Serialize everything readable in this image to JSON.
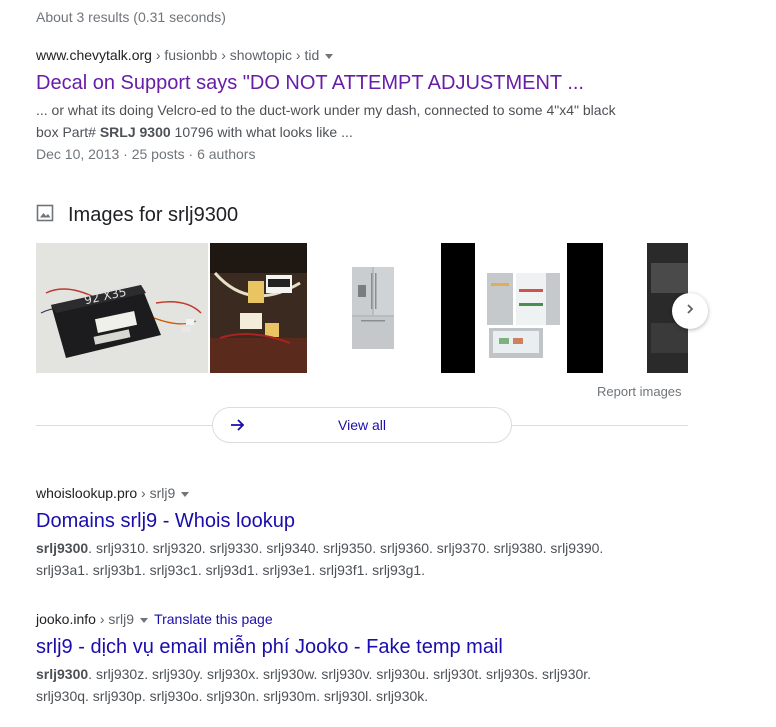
{
  "stats": "About 3 results (0.31 seconds)",
  "results": [
    {
      "domain": "www.chevytalk.org",
      "path": " › fusionbb › showtopic › tid",
      "title": "Decal on Support says \"DO NOT ATTEMPT ADJUSTMENT ...",
      "snippet_line1": "... or what its doing Velcro-ed to the duct-work under my dash, connected to some 4\"x4\" black",
      "snippet_line2_pre": "box Part# ",
      "snippet_line2_bold": "SRLJ 9300",
      "snippet_line2_post": " 10796 with what looks like ...",
      "meta": "Dec 10, 2013 · 25 posts · 6 authors"
    },
    {
      "domain": "whoislookup.pro",
      "path": " › srlj9",
      "title": "Domains srlj9 - Whois lookup",
      "snippet_bold": "srlj9300",
      "snippet_line1": ". srlj9310. srlj9320. srlj9330. srlj9340. srlj9350. srlj9360. srlj9370. srlj9380. srlj9390.",
      "snippet_line2": "srlj93a1. srlj93b1. srlj93c1. srlj93d1. srlj93e1. srlj93f1. srlj93g1."
    },
    {
      "domain": "jooko.info",
      "path": " › srlj9",
      "translate": "Translate this page",
      "title": "srlj9 - dịch vụ email miễn phí Jooko - Fake temp mail",
      "snippet_bold": "srlj9300",
      "snippet_line1": ". srlj930z. srlj930y. srlj930x. srlj930w. srlj930v. srlj930u. srlj930t. srlj930s. srlj930r.",
      "snippet_line2": "srlj930q. srlj930p. srlj930o. srlj930n. srlj930m. srlj930l. srlj930k."
    }
  ],
  "images": {
    "heading": "Images for srlj9300",
    "report": "Report images",
    "view_all": "View all",
    "thumb1_label": "92 X35"
  },
  "colors": {
    "link": "#1a0dab",
    "visited": "#681da8",
    "text": "#4d5156",
    "muted": "#70757a"
  }
}
